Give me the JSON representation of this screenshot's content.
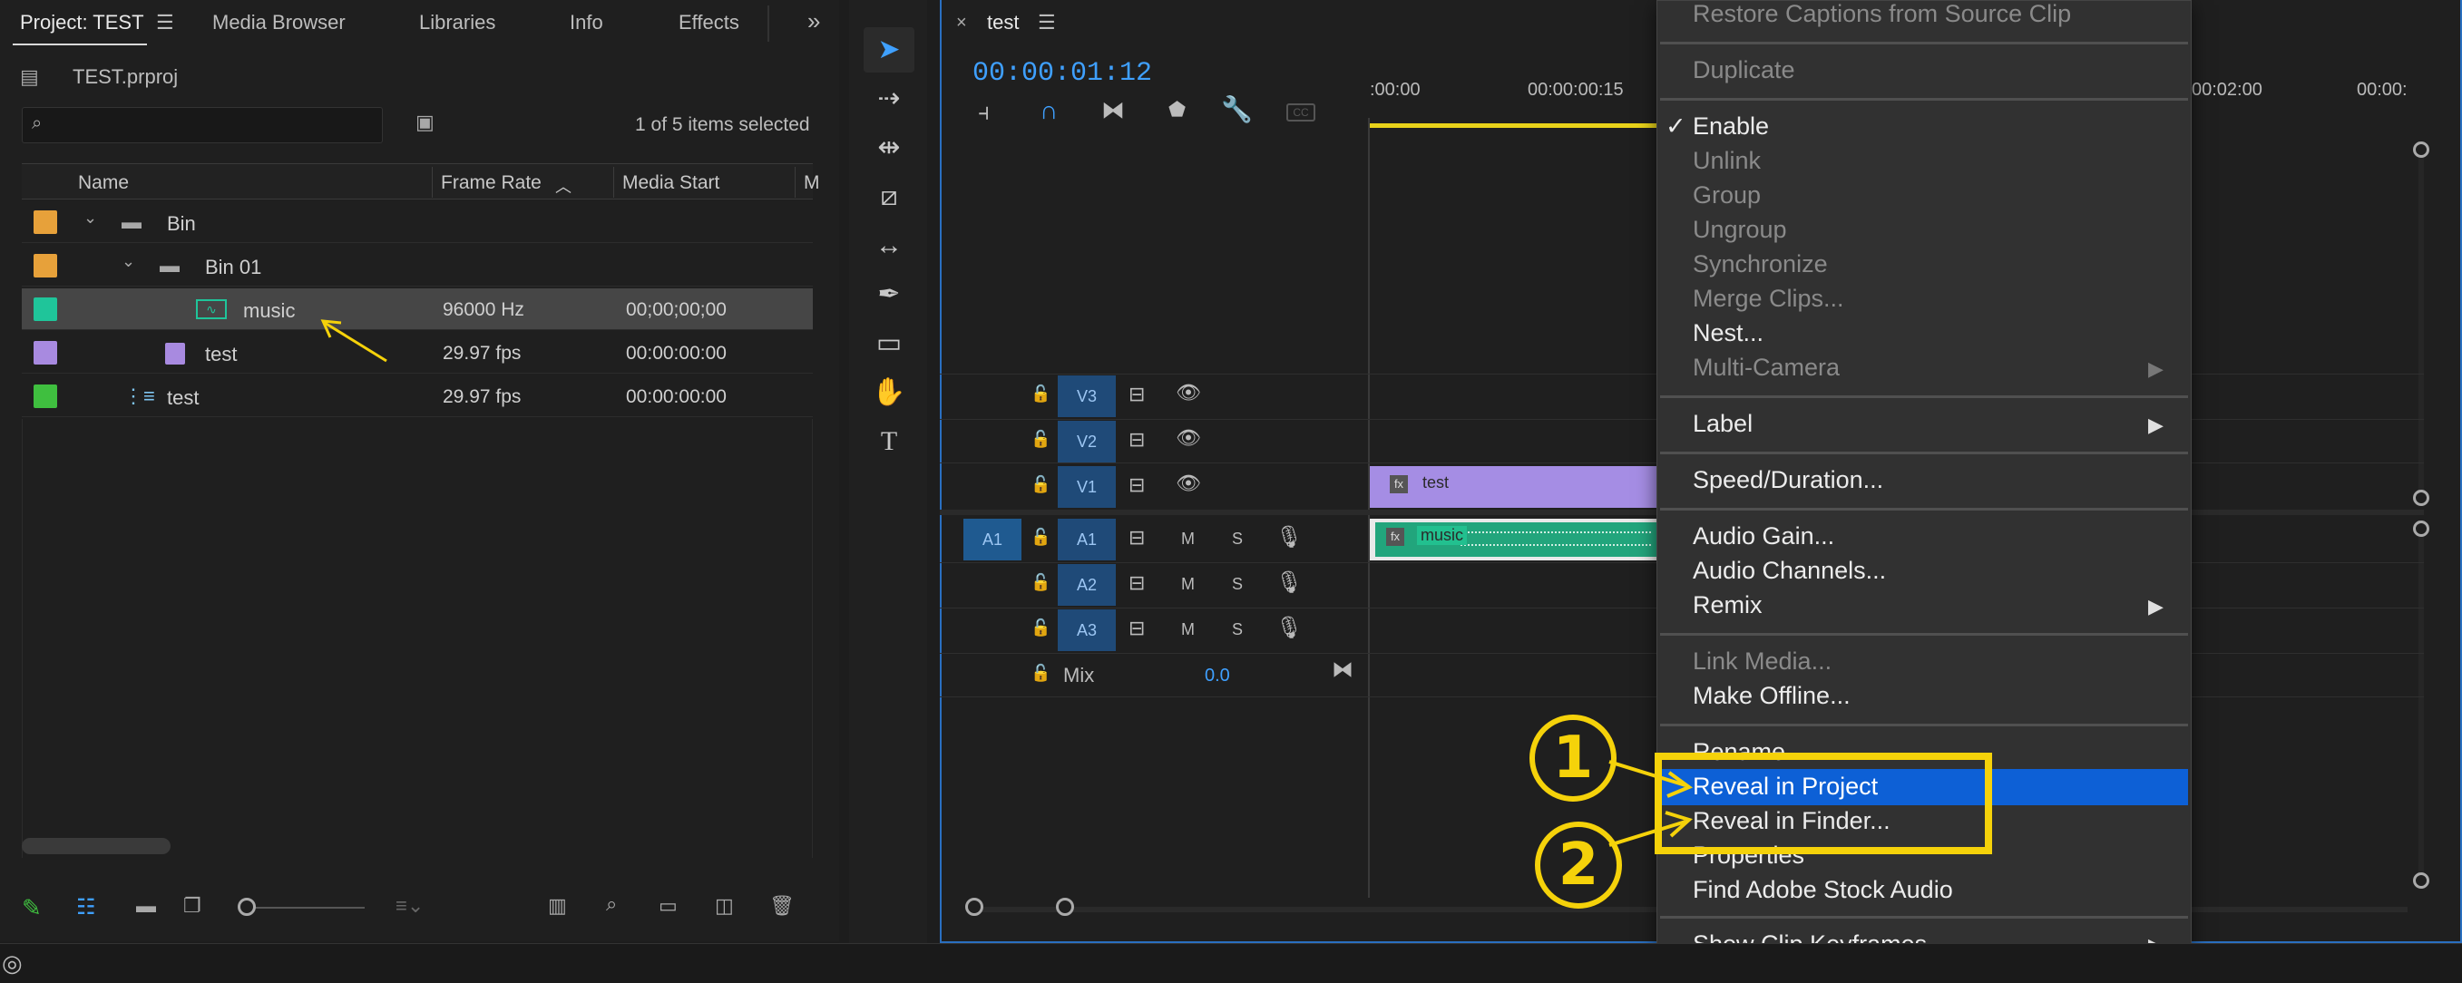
{
  "project_panel": {
    "tabs": [
      "Project: TEST",
      "Media Browser",
      "Libraries",
      "Info",
      "Effects"
    ],
    "file_name": "TEST.prproj",
    "selection_status": "1 of 5 items selected",
    "columns": [
      "Name",
      "Frame Rate",
      "Media Start",
      "M"
    ],
    "rows": [
      {
        "name": "Bin",
        "frame_rate": "",
        "media_start": "",
        "label_color": "#e7a13a"
      },
      {
        "name": "Bin 01",
        "frame_rate": "",
        "media_start": "",
        "label_color": "#e7a13a"
      },
      {
        "name": "music",
        "frame_rate": "96000 Hz",
        "media_start": "00;00;00;00",
        "label_color": "#1fc59a"
      },
      {
        "name": "test",
        "frame_rate": "29.97 fps",
        "media_start": "00:00:00:00",
        "label_color": "#a88ae0"
      },
      {
        "name": "test",
        "frame_rate": "29.97 fps",
        "media_start": "00:00:00:00",
        "label_color": "#3fbf3f"
      }
    ]
  },
  "timeline": {
    "tab": "test",
    "timecode": "00:00:01:12",
    "ruler": [
      ":00:00",
      "00:00:00:15",
      "00:02:00",
      "00:00:"
    ],
    "video_tracks": [
      "V3",
      "V2",
      "V1"
    ],
    "audio_tracks": [
      "A1",
      "A2",
      "A3"
    ],
    "source_patch": "A1",
    "mix_label": "Mix",
    "mix_value": "0.0",
    "clip_video": "test",
    "clip_audio": "music",
    "fx": "fx",
    "m": "M",
    "s": "S"
  },
  "context_menu": {
    "items": [
      {
        "label": "Restore Captions from Source Clip",
        "enabled": false
      },
      {
        "label": "Duplicate",
        "enabled": false
      },
      {
        "label": "Enable",
        "enabled": true,
        "checked": true
      },
      {
        "label": "Unlink",
        "enabled": false
      },
      {
        "label": "Group",
        "enabled": false
      },
      {
        "label": "Ungroup",
        "enabled": false
      },
      {
        "label": "Synchronize",
        "enabled": false
      },
      {
        "label": "Merge Clips...",
        "enabled": false
      },
      {
        "label": "Nest...",
        "enabled": true
      },
      {
        "label": "Multi-Camera",
        "enabled": false
      },
      {
        "label": "Label",
        "enabled": true
      },
      {
        "label": "Speed/Duration...",
        "enabled": true
      },
      {
        "label": "Audio Gain...",
        "enabled": true
      },
      {
        "label": "Audio Channels...",
        "enabled": true
      },
      {
        "label": "Remix",
        "enabled": true
      },
      {
        "label": "Link Media...",
        "enabled": false
      },
      {
        "label": "Make Offline...",
        "enabled": true
      },
      {
        "label": "Rename...",
        "enabled": true
      },
      {
        "label": "Reveal in Project",
        "enabled": true,
        "highlighted": true
      },
      {
        "label": "Reveal in Finder...",
        "enabled": true
      },
      {
        "label": "Properties",
        "enabled": true
      },
      {
        "label": "Find Adobe Stock Audio",
        "enabled": true
      },
      {
        "label": "Show Clip Keyframes",
        "enabled": true
      }
    ],
    "checkmark": "✓",
    "submenu_arrow": "▶"
  },
  "annotations": {
    "step1": "1",
    "step2": "2"
  },
  "colors": {
    "accent": "#0d60d6",
    "annotation": "#f5d20a",
    "timecode": "#3fa0ff"
  }
}
